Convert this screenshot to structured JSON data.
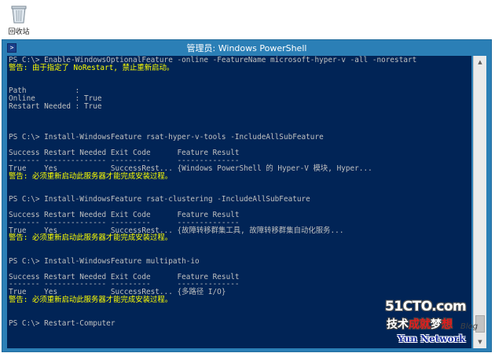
{
  "desktop": {
    "recycle_bin_label": "回收站",
    "recycle_bin_icon": "recycle-bin-icon"
  },
  "window": {
    "title": "管理员: Windows PowerShell",
    "icon": "powershell-icon",
    "title_color": "#ffffff",
    "frame_color": "#2b7fb6"
  },
  "console": {
    "background": "#012456",
    "foreground": "#c0c0c0",
    "warning_color": "#ffff00",
    "lines": [
      {
        "text": "PS C:\\> Enable-WindowsOptionalFeature -online -FeatureName microsoft-hyper-v -all -norestart",
        "type": "normal"
      },
      {
        "text": "警告: 由于指定了 NoRestart, 禁止重新启动。",
        "type": "warn"
      },
      {
        "text": "",
        "type": "normal"
      },
      {
        "text": "",
        "type": "normal"
      },
      {
        "text": "Path           :",
        "type": "normal"
      },
      {
        "text": "Online         : True",
        "type": "normal"
      },
      {
        "text": "Restart Needed : True",
        "type": "normal"
      },
      {
        "text": "",
        "type": "normal"
      },
      {
        "text": "",
        "type": "normal"
      },
      {
        "text": "",
        "type": "normal"
      },
      {
        "text": "PS C:\\> Install-WindowsFeature rsat-hyper-v-tools -IncludeAllSubFeature",
        "type": "normal"
      },
      {
        "text": "",
        "type": "normal"
      },
      {
        "text": "Success Restart Needed Exit Code      Feature Result",
        "type": "normal"
      },
      {
        "text": "------- -------------- ---------      --------------",
        "type": "normal"
      },
      {
        "text": "True    Yes            SuccessRest... {Windows PowerShell 的 Hyper-V 模块, Hyper...",
        "type": "normal"
      },
      {
        "text": "警告: 必须重新启动此服务器才能完成安装过程。",
        "type": "warn"
      },
      {
        "text": "",
        "type": "normal"
      },
      {
        "text": "",
        "type": "normal"
      },
      {
        "text": "PS C:\\> Install-WindowsFeature rsat-clustering -IncludeAllSubFeature",
        "type": "normal"
      },
      {
        "text": "",
        "type": "normal"
      },
      {
        "text": "Success Restart Needed Exit Code      Feature Result",
        "type": "normal"
      },
      {
        "text": "------- -------------- ---------      --------------",
        "type": "normal"
      },
      {
        "text": "True    Yes            SuccessRest... {故障转移群集工具, 故障转移群集自动化服务...",
        "type": "normal"
      },
      {
        "text": "警告: 必须重新启动此服务器才能完成安装过程。",
        "type": "warn"
      },
      {
        "text": "",
        "type": "normal"
      },
      {
        "text": "",
        "type": "normal"
      },
      {
        "text": "PS C:\\> Install-WindowsFeature multipath-io",
        "type": "normal"
      },
      {
        "text": "",
        "type": "normal"
      },
      {
        "text": "Success Restart Needed Exit Code      Feature Result",
        "type": "normal"
      },
      {
        "text": "------- -------------- ---------      --------------",
        "type": "normal"
      },
      {
        "text": "True    Yes            SuccessRest... {多路径 I/O}",
        "type": "normal"
      },
      {
        "text": "警告: 必须重新启动此服务器才能完成安装过程。",
        "type": "warn"
      },
      {
        "text": "",
        "type": "normal"
      },
      {
        "text": "",
        "type": "normal"
      },
      {
        "text": "PS C:\\> Restart-Computer",
        "type": "normal"
      }
    ]
  },
  "scrollbar": {
    "up_icon": "scroll-up-arrow-icon",
    "down_icon": "scroll-down-arrow-icon"
  },
  "watermark": {
    "top": "51CTO.com",
    "mid_a": "技",
    "mid_b": "术",
    "mid_c": "成",
    "mid_d": "就",
    "mid_e": "梦",
    "mid_f": "想",
    "blog": "Blog",
    "bottom": "Yun Network"
  }
}
